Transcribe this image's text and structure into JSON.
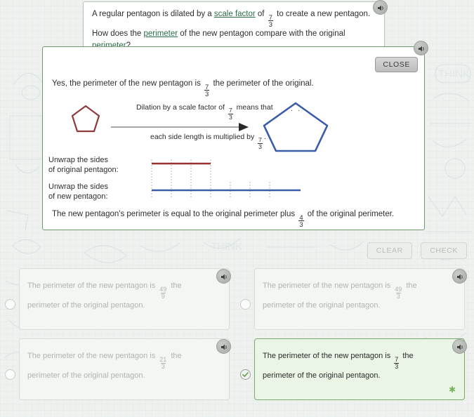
{
  "question": {
    "text_1": "A regular pentagon is dilated by a ",
    "link_scale_factor": "scale factor",
    "text_2": " of ",
    "frac_num": "7",
    "frac_den": "3",
    "text_3": " to create a new pentagon. How does the ",
    "link_perimeter_1": "perimeter",
    "text_4": " of the new pentagon compare with the original ",
    "link_perimeter_2": "perimeter",
    "text_5": "?"
  },
  "explanation": {
    "close_label": "CLOSE",
    "line1_a": "Yes, the perimeter of the new pentagon is ",
    "line1_frac_num": "7",
    "line1_frac_den": "3",
    "line1_b": " the perimeter of the original.",
    "diagram": {
      "top_text_a": "Dilation by a scale factor of ",
      "top_frac_num": "7",
      "top_frac_den": "3",
      "top_text_b": " means that",
      "ellipsis": ". . .",
      "bottom_text_a": "each side length is multiplied by ",
      "bottom_frac_num": "7",
      "bottom_frac_den": "3",
      "bottom_text_b": ".",
      "small_pentagon_color": "#8f3b3b",
      "large_pentagon_color": "#3a5ba8"
    },
    "unwrap": {
      "label_original_l1": "Unwrap the sides",
      "label_original_l2": "of original pentagon:",
      "label_new_l1": "Unwrap the sides",
      "label_new_l2": "of new pentagon:",
      "original_segments": 3,
      "new_segments": 7,
      "original_color": "#9b3030",
      "new_color": "#3a5ba8"
    },
    "line2_a": "The new pentagon's perimeter is equal to the original perimeter plus ",
    "line2_frac_num": "4",
    "line2_frac_den": "3",
    "line2_b": " of the original perimeter."
  },
  "controls": {
    "clear_label": "CLEAR",
    "check_label": "CHECK"
  },
  "options": [
    {
      "id": "a",
      "text_a": "The perimeter of the new pentagon is ",
      "frac_num": "49",
      "frac_den": "9",
      "text_b": " the perimeter of the original pentagon.",
      "selected": false
    },
    {
      "id": "b",
      "text_a": "The perimeter of the new pentagon is ",
      "frac_num": "49",
      "frac_den": "3",
      "text_b": " the perimeter of the original pentagon.",
      "selected": false
    },
    {
      "id": "c",
      "text_a": "The perimeter of the new pentagon is ",
      "frac_num": "21",
      "frac_den": "3",
      "text_b": " the perimeter of the original pentagon.",
      "selected": false
    },
    {
      "id": "d",
      "text_a": "The perimeter of the new pentagon is ",
      "frac_num": "7",
      "frac_den": "3",
      "text_b": " the perimeter of the original pentagon.",
      "selected": true
    }
  ],
  "colors": {
    "panel_border": "#6e9a6e",
    "correct_bg": "#eaf5e5",
    "correct_border": "#7aa86d",
    "link": "#2c6e49"
  }
}
